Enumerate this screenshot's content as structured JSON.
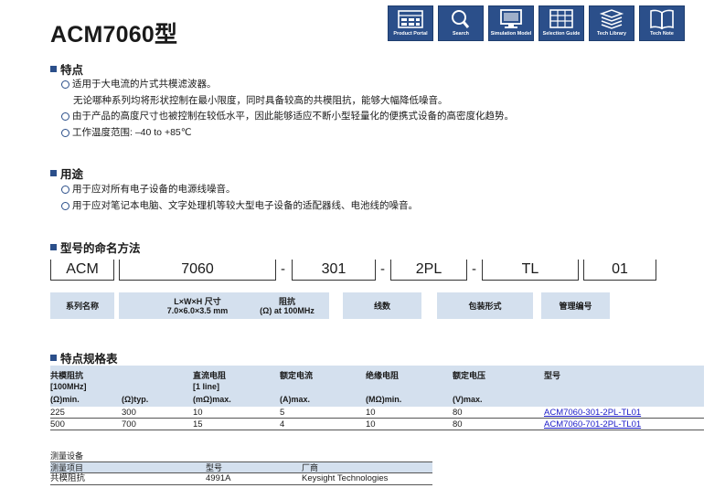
{
  "title": "ACM7060",
  "title_suffix": "型",
  "nav": [
    {
      "label": "Product Portal",
      "icon": "product-portal-icon"
    },
    {
      "label": "Search",
      "icon": "search-icon"
    },
    {
      "label": "Simulation Model",
      "icon": "monitor-icon"
    },
    {
      "label": "Selection Guide",
      "icon": "grid-icon"
    },
    {
      "label": "Tech Library",
      "icon": "books-icon"
    },
    {
      "label": "Tech Note",
      "icon": "open-book-icon"
    }
  ],
  "features": {
    "heading": "特点",
    "items": [
      {
        "text": "适用于大电流的片式共模滤波器。",
        "bullet": true
      },
      {
        "text": "无论哪种系列均将形状控制在最小限度，同时具备较高的共模阻抗，能够大幅降低噪音。",
        "bullet": false
      },
      {
        "text": "由于产品的高度尺寸也被控制在较低水平，因此能够适应不断小型轻量化的便携式设备的高密度化趋势。",
        "bullet": true
      },
      {
        "text": "工作温度范围: –40 to +85℃",
        "bullet": true
      }
    ]
  },
  "applications": {
    "heading": "用途",
    "items": [
      {
        "text": "用于应对所有电子设备的电源线噪音。",
        "bullet": true
      },
      {
        "text": "用于应对笔记本电脑、文字处理机等较大型电子设备的适配器线、电池线的噪音。",
        "bullet": true
      }
    ]
  },
  "naming": {
    "heading": "型号的命名方法",
    "parts": [
      "ACM",
      "7060",
      "301",
      "2PL",
      "TL",
      "01"
    ],
    "dash": "-",
    "labels": [
      {
        "line1": "系列名称",
        "line2": ""
      },
      {
        "line1": "L×W×H 尺寸",
        "line2": "7.0×6.0×3.5 mm"
      },
      {
        "line1": "阻抗",
        "line2": "(Ω) at 100MHz"
      },
      {
        "line1": "线数",
        "line2": ""
      },
      {
        "line1": "包装形式",
        "line2": ""
      },
      {
        "line1": "管理编号",
        "line2": ""
      }
    ]
  },
  "spec_table": {
    "heading": "特点规格表",
    "headers": {
      "impedance": "共模阻抗",
      "impedance_freq": "[100MHz]",
      "impedance_min": "(Ω)min.",
      "impedance_typ": "(Ω)typ.",
      "dc_resistance": "直流电阻",
      "dc_resistance_note": "[1 line]",
      "dc_resistance_unit": "(mΩ)max.",
      "rated_current": "额定电流",
      "rated_current_unit": "(A)max.",
      "insulation": "绝缘电阻",
      "insulation_unit": "(MΩ)min.",
      "rated_voltage": "额定电压",
      "rated_voltage_unit": "(V)max.",
      "part_number": "型号"
    },
    "rows": [
      {
        "min": "225",
        "typ": "300",
        "dcr": "10",
        "current": "5",
        "insulation": "10",
        "voltage": "80",
        "part": "ACM7060-301-2PL-TL01"
      },
      {
        "min": "500",
        "typ": "700",
        "dcr": "15",
        "current": "4",
        "insulation": "10",
        "voltage": "80",
        "part": "ACM7060-701-2PL-TL01"
      }
    ]
  },
  "measurement": {
    "title": "测量设备",
    "headers": {
      "item": "测量项目",
      "model": "型号",
      "maker": "厂商"
    },
    "rows": [
      {
        "item": "共模阻抗",
        "model": "4991A",
        "maker": "Keysight Technologies"
      }
    ]
  },
  "colors": {
    "brand": "#2b4f8a",
    "header_fill": "#d4e0ee",
    "link": "#1a1ac8"
  }
}
